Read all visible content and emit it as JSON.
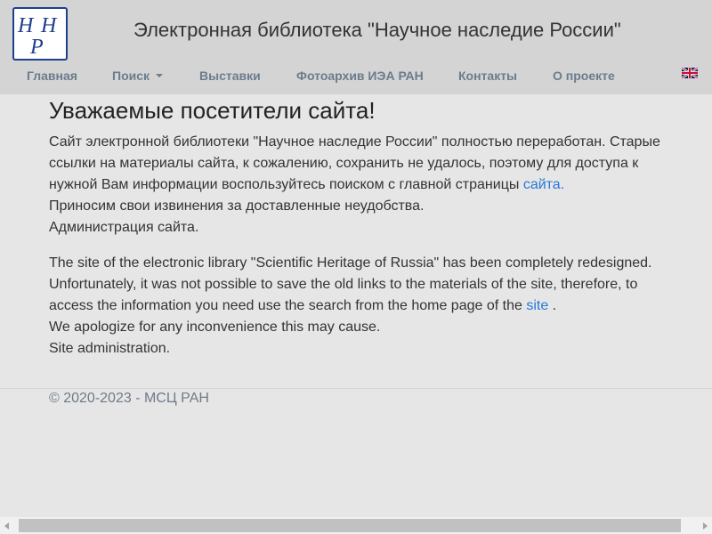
{
  "header": {
    "logo_letters": "НН Р",
    "site_title": "Электронная библиотека \"Научное наследие России\""
  },
  "nav": {
    "items": [
      {
        "label": "Главная"
      },
      {
        "label": "Поиск",
        "has_dropdown": true
      },
      {
        "label": "Выставки"
      },
      {
        "label": "Фотоархив ИЭА РАН"
      },
      {
        "label": "Контакты"
      },
      {
        "label": "О проекте"
      }
    ],
    "language_icon": "uk-flag-icon"
  },
  "main": {
    "heading": "Уважаемые посетители сайта!",
    "ru": {
      "line1": "Сайт электронной библиотеки \"Научное наследие России\" полностью переработан. Старые",
      "line2": "ссылки на материалы сайта, к сожалению, сохранить не удалось, поэтому для доступа к",
      "line3_text": "нужной Вам информации воспользуйтесь поиском с главной страницы ",
      "line3_link": "сайта",
      "line3_after": ".",
      "line4": "Приносим свои извинения за доставленные неудобства.",
      "line5": "Администрация сайта."
    },
    "en": {
      "line1": "The site of the electronic library \"Scientific Heritage of Russia\" has been completely redesigned.",
      "line2": "Unfortunately, it was not possible to save the old links to the materials of the site, therefore, to",
      "line3_text": "access the information you need use the search from the home page of the ",
      "line3_link": "site",
      "line3_after": " .",
      "line4": "We apologize for any inconvenience this may cause.",
      "line5": "Site administration."
    }
  },
  "footer": {
    "copyright": "© 2020-2023 - МСЦ РАН"
  },
  "colors": {
    "page_bg": "#e6e6e6",
    "header_bg": "#d4d4d4",
    "nav_text": "#6c7c8c",
    "link": "#2878d8",
    "logo_blue": "#1f3f8f"
  }
}
